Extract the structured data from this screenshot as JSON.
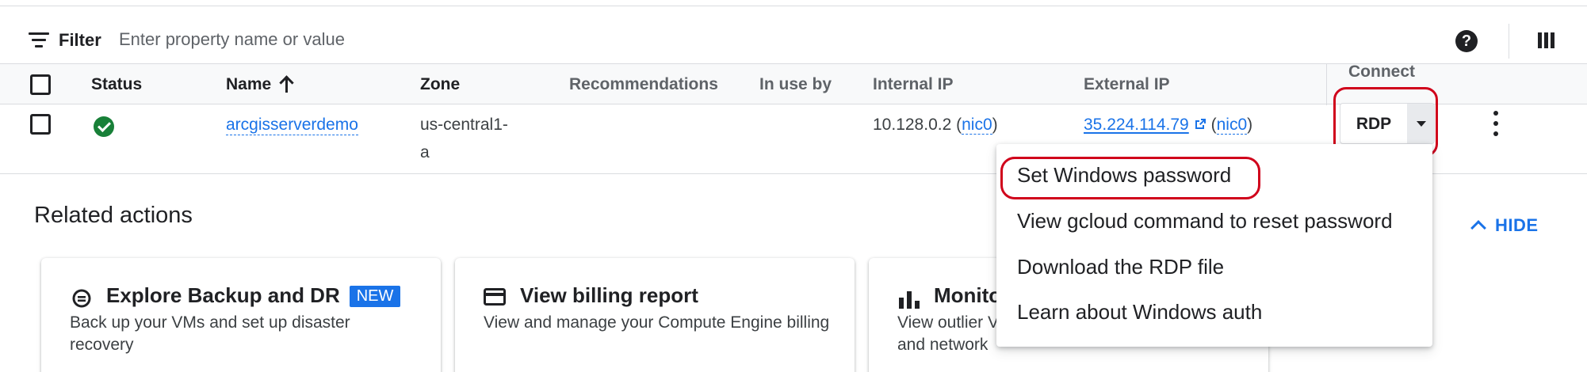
{
  "filter": {
    "label": "Filter",
    "placeholder": "Enter property name or value",
    "value": ""
  },
  "toolbar": {
    "help_icon": "help-icon",
    "help_glyph": "?",
    "columns_icon": "columns-icon"
  },
  "table": {
    "headers": {
      "status": "Status",
      "name": "Name",
      "zone": "Zone",
      "recommendations": "Recommendations",
      "in_use_by": "In use by",
      "internal_ip": "Internal IP",
      "external_ip": "External IP",
      "connect": "Connect"
    },
    "rows": [
      {
        "status": "running",
        "name": "arcgisserverdemo",
        "zone_line1": "us-central1-",
        "zone_line2": "a",
        "internal_ip": "10.128.0.2",
        "internal_nic": "nic0",
        "external_ip": "35.224.114.79",
        "external_nic": "nic0",
        "connect": "RDP"
      }
    ]
  },
  "paren_open": "(",
  "paren_close": ")",
  "connect_menu": {
    "items": [
      "Set Windows password",
      "View gcloud command to reset password",
      "Download the RDP file",
      "Learn about Windows auth"
    ]
  },
  "related": {
    "title": "Related actions",
    "hide_label": "HIDE",
    "cards": [
      {
        "icon": "backup-icon",
        "title": "Explore Backup and DR",
        "badge": "NEW",
        "desc": "Back up your VMs and set up disaster recovery"
      },
      {
        "icon": "billing-card-icon",
        "title": "View billing report",
        "desc": "View and manage your Compute Engine billing"
      },
      {
        "icon": "bar-chart-icon",
        "title": "Monito",
        "desc_line1": "View outlier V",
        "desc_line2": "and network"
      }
    ]
  },
  "colors": {
    "accent": "#1a73e8",
    "status_ok": "#188038",
    "highlight": "#d0021b"
  }
}
